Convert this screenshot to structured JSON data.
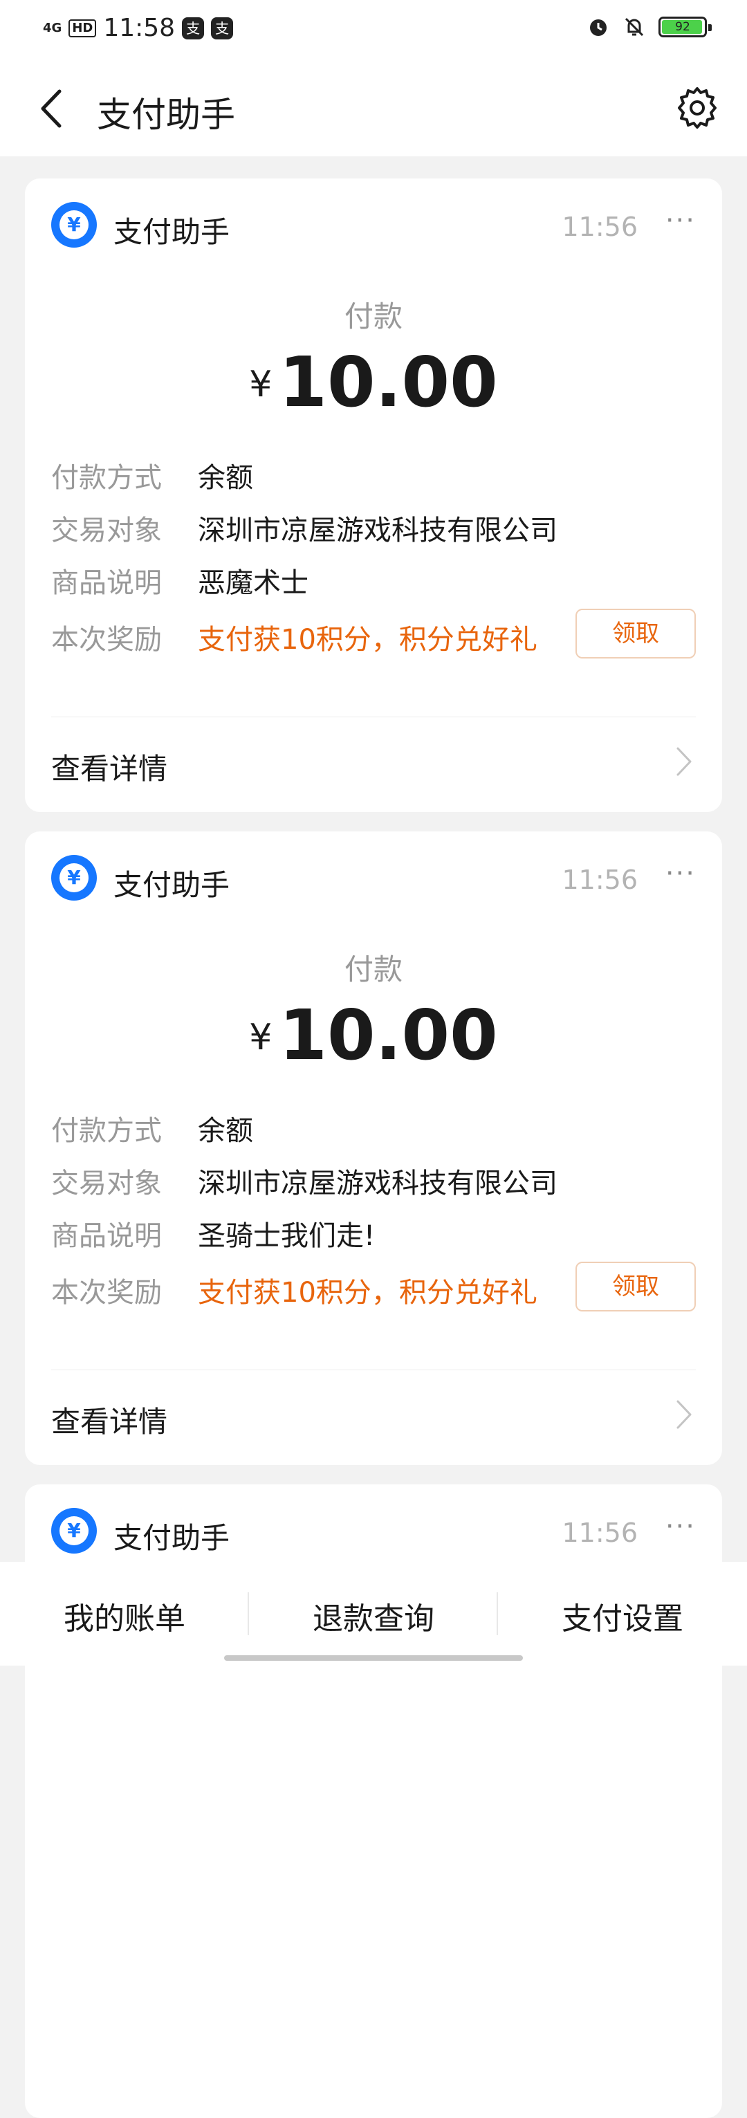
{
  "status_bar": {
    "network": "4G",
    "hd": "HD",
    "time": "11:58",
    "app_icon": "支",
    "battery": "92",
    "icons": [
      "alarm-icon",
      "bell-off-icon",
      "battery-icon"
    ]
  },
  "navbar": {
    "title": "支付助手",
    "back_icon": "back-arrow-icon",
    "settings_icon": "gear-icon"
  },
  "cards": [
    {
      "sender": "支付助手",
      "time": "11:56",
      "more": "···",
      "pay_label": "付款",
      "currency": "¥",
      "amount": "10.00",
      "rows": [
        {
          "label": "付款方式",
          "value": "余额"
        },
        {
          "label": "交易对象",
          "value": "深圳市凉屋游戏科技有限公司"
        },
        {
          "label": "商品说明",
          "value": "恶魔术士"
        },
        {
          "label": "本次奖励",
          "value": "支付获10积分，积分兑好礼"
        }
      ],
      "claim_label": "领取",
      "detail_label": "查看详情"
    },
    {
      "sender": "支付助手",
      "time": "11:56",
      "more": "···",
      "pay_label": "付款",
      "currency": "¥",
      "amount": "10.00",
      "rows": [
        {
          "label": "付款方式",
          "value": "余额"
        },
        {
          "label": "交易对象",
          "value": "深圳市凉屋游戏科技有限公司"
        },
        {
          "label": "商品说明",
          "value": "圣骑士我们走!"
        },
        {
          "label": "本次奖励",
          "value": "支付获10积分，积分兑好礼"
        }
      ],
      "claim_label": "领取",
      "detail_label": "查看详情"
    },
    {
      "sender": "支付助手",
      "time": "11:56",
      "more": "···"
    }
  ],
  "bottom_tabs": [
    "我的账单",
    "退款查询",
    "支付设置"
  ],
  "colors": {
    "brand_blue": "#1677ff",
    "reward_orange": "#e8650d",
    "background": "#f2f2f2"
  }
}
